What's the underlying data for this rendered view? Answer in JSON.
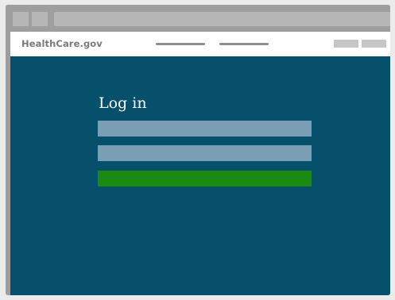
{
  "browser": {
    "tabs": [
      "",
      ""
    ],
    "address": ""
  },
  "navbar": {
    "brand": "HealthCare.gov",
    "links": [
      "",
      ""
    ],
    "buttons": [
      "",
      ""
    ]
  },
  "login": {
    "title": "Log in",
    "username_value": "",
    "password_value": "",
    "submit_label": ""
  },
  "colors": {
    "page_background": "#07506c",
    "field": "#7a9fb4",
    "submit": "#1a8a12",
    "navbar": "#ffffff",
    "chrome": "#9e9e9e"
  }
}
